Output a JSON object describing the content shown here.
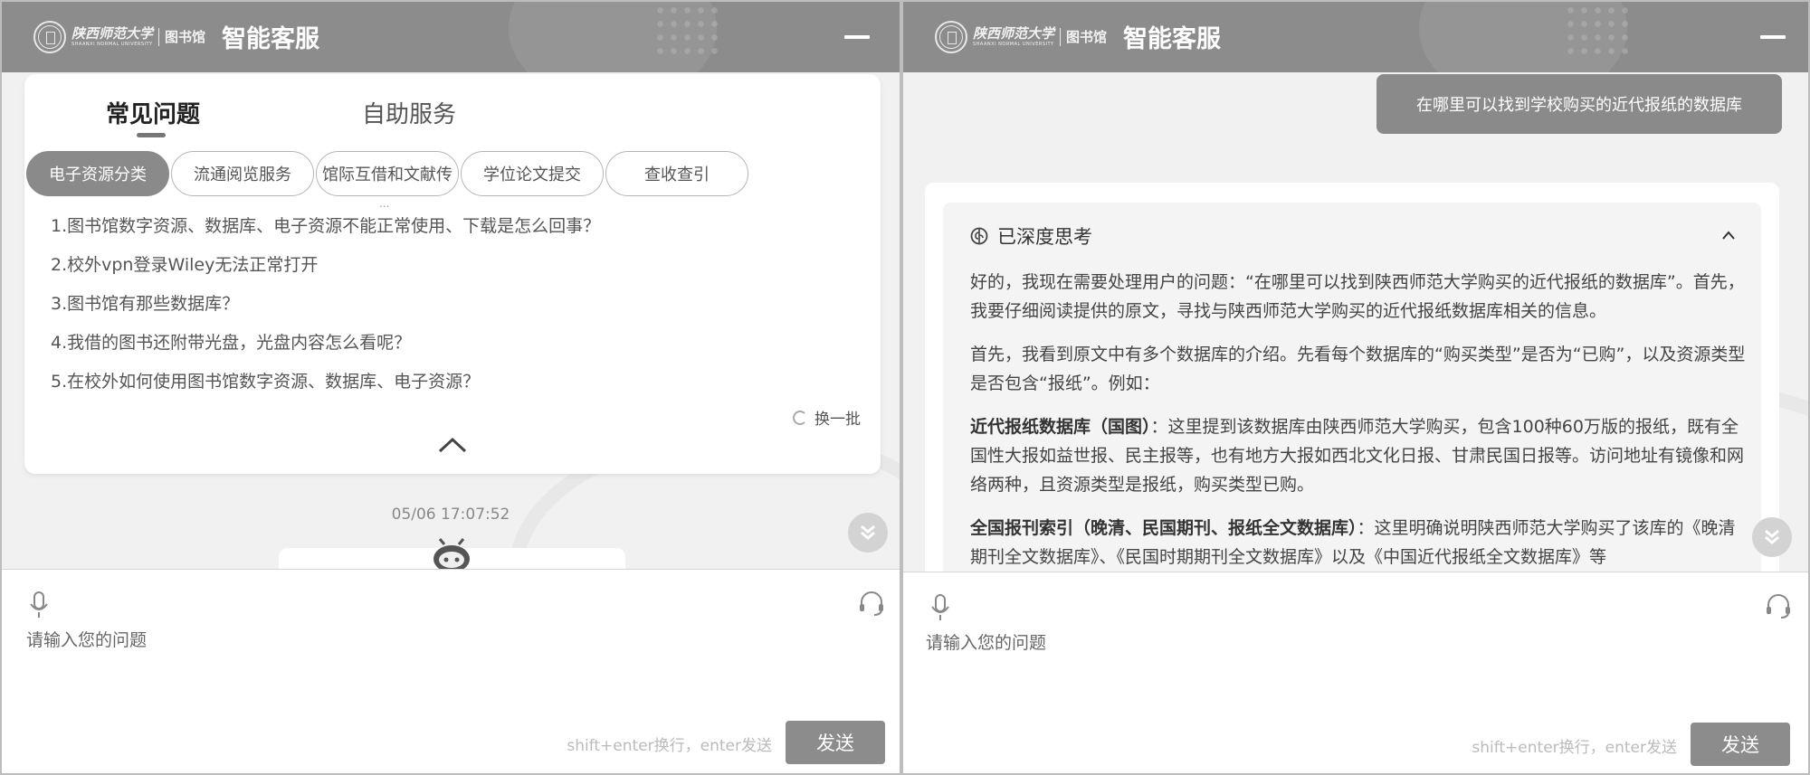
{
  "left": {
    "header": {
      "university": "陕西师范大学",
      "university_en": "SHAANXI NORMAL UNIVERSITY",
      "library": "图书馆",
      "title": "智能客服"
    },
    "tabs": [
      "常见问题",
      "自助服务"
    ],
    "categories": [
      "电子资源分类",
      "流通阅览服务",
      "馆际互借和文献传",
      "学位论文提交",
      "查收查引"
    ],
    "more_indicator": "...",
    "questions": [
      "1.图书馆数字资源、数据库、电子资源不能正常使用、下载是怎么回事？",
      "2.校外vpn登录Wiley无法正常打开",
      "3.图书馆有那些数据库？",
      "4.我借的图书还附带光盘，光盘内容怎么看呢？",
      "5.在校外如何使用图书馆数字资源、数据库、电子资源？"
    ],
    "refresh_label": "换一批",
    "timestamp": "05/06 17:07:52",
    "input": {
      "placeholder": "请输入您的问题",
      "hint": "shift+enter换行，enter发送",
      "send": "发送"
    }
  },
  "right": {
    "header": {
      "university": "陕西师范大学",
      "university_en": "SHAANXI NORMAL UNIVERSITY",
      "library": "图书馆",
      "title": "智能客服"
    },
    "user_message": "在哪里可以找到学校购买的近代报纸的数据库",
    "thinking": {
      "title": "已深度思考",
      "p1": "好的，我现在需要处理用户的问题：“在哪里可以找到陕西师范大学购买的近代报纸的数据库”。首先，我要仔细阅读提供的原文，寻找与陕西师范大学购买的近代报纸数据库相关的信息。",
      "p2": "首先，我看到原文中有多个数据库的介绍。先看每个数据库的“购买类型”是否为“已购”，以及资源类型是否包含“报纸”。例如：",
      "p3_bold": "近代报纸数据库（国图）",
      "p3": "：这里提到该数据库由陕西师范大学购买，包含100种60万版的报纸，既有全国性大报如益世报、民主报等，也有地方大报如西北文化日报、甘肃民国日报等。访问地址有镜像和网络两种，且资源类型是报纸，购买类型已购。",
      "p4_bold": "全国报刊索引（晚清、民国期刊、报纸全文数据库）",
      "p4": "：这里明确说明陕西师范大学购买了该库的《晚清期刊全文数据库》、《民国时期期刊全文数据库》以及《中国近代报纸全文数据库》等"
    },
    "input": {
      "placeholder": "请输入您的问题",
      "hint": "shift+enter换行，enter发送",
      "send": "发送"
    }
  }
}
